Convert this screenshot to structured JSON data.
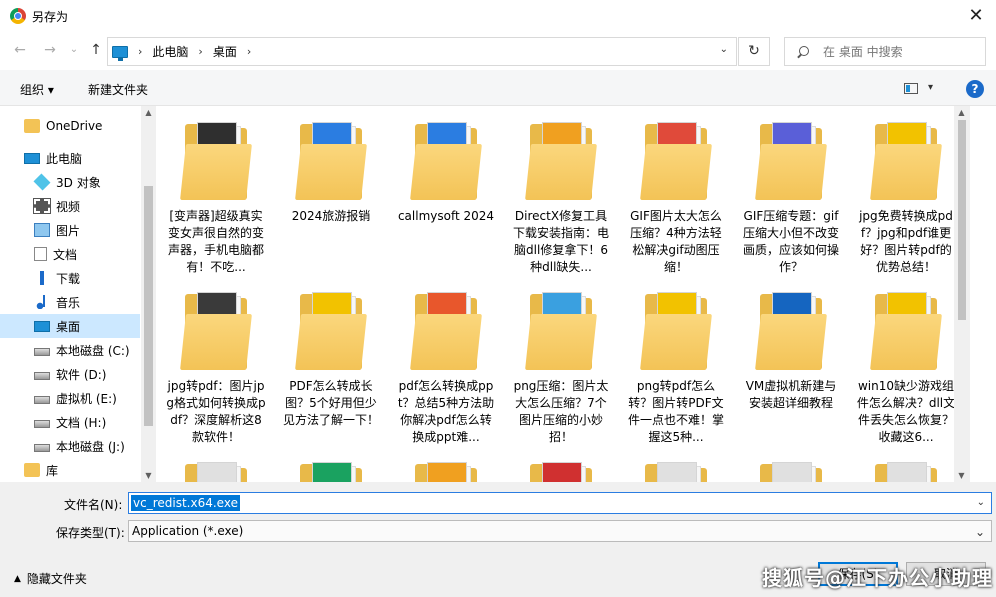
{
  "window": {
    "title": "另存为",
    "close_glyph": "✕"
  },
  "address": {
    "back_glyph": "←",
    "forward_glyph": "→",
    "recent_glyph": "⌄",
    "up_glyph": "↑",
    "breadcrumbs": [
      "此电脑",
      "桌面"
    ],
    "sep": "›",
    "dropdown_glyph": "⌄",
    "refresh_glyph": "↻",
    "search_placeholder": "在 桌面 中搜索"
  },
  "toolbar": {
    "organize": "组织 ▾",
    "new_folder": "新建文件夹",
    "view_dd": "▾",
    "help": "?"
  },
  "nav": {
    "items": [
      {
        "label": "OneDrive",
        "icon": "onedrive-folder-icon"
      },
      {
        "label": "此电脑",
        "icon": "computer-icon"
      },
      {
        "label": "3D 对象",
        "icon": "3d-objects-icon"
      },
      {
        "label": "视频",
        "icon": "video-icon"
      },
      {
        "label": "图片",
        "icon": "pictures-icon"
      },
      {
        "label": "文档",
        "icon": "documents-icon"
      },
      {
        "label": "下载",
        "icon": "download-icon"
      },
      {
        "label": "音乐",
        "icon": "music-icon"
      },
      {
        "label": "桌面",
        "icon": "desktop-icon",
        "selected": true
      },
      {
        "label": "本地磁盘 (C:)",
        "icon": "drive-icon"
      },
      {
        "label": "软件 (D:)",
        "icon": "drive-icon"
      },
      {
        "label": "虚拟机 (E:)",
        "icon": "drive-icon"
      },
      {
        "label": "文档 (H:)",
        "icon": "drive-icon"
      },
      {
        "label": "本地磁盘 (J:)",
        "icon": "drive-icon"
      },
      {
        "label": "库",
        "icon": "library-icon"
      }
    ]
  },
  "folders": [
    {
      "label": "[变声器]超级真实变女声很自然的变声器，手机电脑都有！不吃...",
      "accent": "#2f2f2f"
    },
    {
      "label": "2024旅游报销",
      "accent": "#2b7de1"
    },
    {
      "label": "callmysoft 2024",
      "accent": "#2b7de1"
    },
    {
      "label": "DirectX修复工具下载安装指南：电脑dll修复拿下！6种dll缺失...",
      "accent": "#f0a020"
    },
    {
      "label": "GIF图片太大怎么压缩？4种方法轻松解决gif动图压缩！",
      "accent": "#e04a3a"
    },
    {
      "label": "GIF压缩专题：gif压缩大小但不改变画质，应该如何操作？",
      "accent": "#5a5fd8"
    },
    {
      "label": "jpg免费转换成pdf？jpg和pdf谁更好？图片转pdf的优势总结！",
      "accent": "#f2c200"
    },
    {
      "label": "jpg转pdf：图片jpg格式如何转换成pdf？深度解析这8款软件！",
      "accent": "#3a3a3a"
    },
    {
      "label": "PDF怎么转成长图？5个好用但少见方法了解一下！",
      "accent": "#f2c200"
    },
    {
      "label": "pdf怎么转换成ppt？总结5种方法助你解决pdf怎么转换成ppt难...",
      "accent": "#e8572c"
    },
    {
      "label": "png压缩：图片太大怎么压缩？7个图片压缩的小妙招！",
      "accent": "#3aa0e0"
    },
    {
      "label": "png转pdf怎么转？图片转PDF文件一点也不难！掌握这5种...",
      "accent": "#f2c200"
    },
    {
      "label": "VM虚拟机新建与安装超详细教程",
      "accent": "#1565c0"
    },
    {
      "label": "win10缺少游戏组件怎么解决？dll文件丢失怎么恢复？收藏这6...",
      "accent": "#f2c200"
    },
    {
      "label": "",
      "accent": "#e0e0e0"
    },
    {
      "label": "",
      "accent": "#1aa260"
    },
    {
      "label": "",
      "accent": "#f0a020"
    },
    {
      "label": "",
      "accent": "#d03030"
    },
    {
      "label": "",
      "accent": "#e0e0e0"
    },
    {
      "label": "",
      "accent": "#e0e0e0"
    },
    {
      "label": "",
      "accent": "#e0e0e0"
    }
  ],
  "form": {
    "filename_label": "文件名(N):",
    "filename_value": "vc_redist.x64.exe",
    "filetype_label": "保存类型(T):",
    "filetype_value": "Application (*.exe)",
    "dd_glyph": "⌄",
    "hide_folders": "隐藏文件夹",
    "hide_caret": "▲",
    "save": "保存(S)",
    "cancel": "取消",
    "watermark": "搜狐号@江下办公小助理"
  }
}
